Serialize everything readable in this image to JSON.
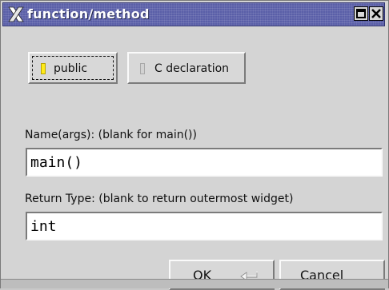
{
  "window": {
    "title": "function/method"
  },
  "options": {
    "public_label": "public",
    "public_on": true,
    "c_declaration_label": "C declaration",
    "c_declaration_on": false
  },
  "name_field": {
    "label": "Name(args): (blank for main())",
    "value": "main()"
  },
  "return_field": {
    "label": "Return Type: (blank to return outermost widget)",
    "value": "int"
  },
  "buttons": {
    "ok_label": "OK",
    "cancel_label": "Cancel"
  },
  "icons": {
    "app": "x-logo-icon",
    "maximize": "maximize-icon",
    "close": "close-icon",
    "ok_shortcut": "return-key-icon"
  },
  "colors": {
    "titlebar": "#5a5fa8",
    "window_bg": "#d4d4d4",
    "led_on": "#ffeb1a",
    "input_bg": "#ffffff"
  }
}
